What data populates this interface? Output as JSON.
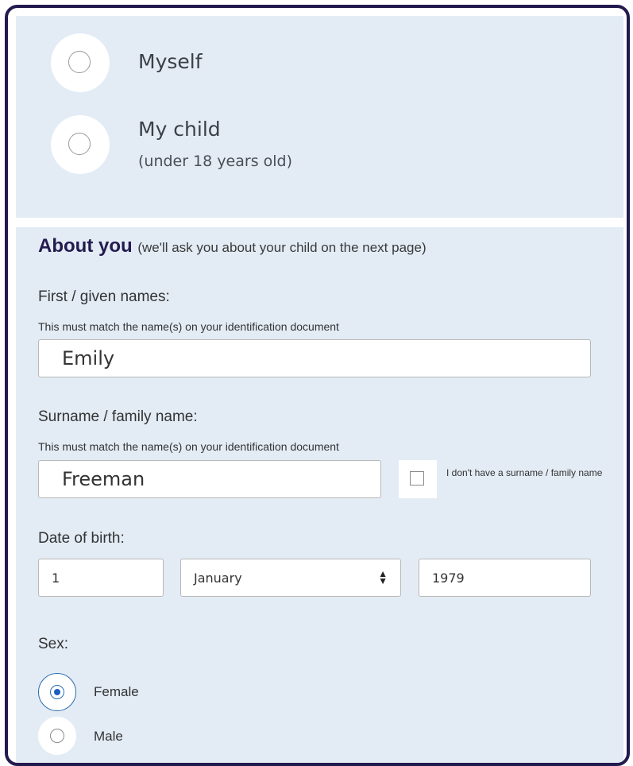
{
  "applicant_choice": {
    "options": [
      {
        "label": "Myself",
        "sublabel": "",
        "selected": false
      },
      {
        "label": "My child",
        "sublabel": "(under 18 years old)",
        "selected": false
      }
    ]
  },
  "about_you": {
    "title": "About you",
    "note": "(we'll ask you about your child on the next page)",
    "first_name": {
      "label": "First / given names:",
      "hint": "This must match the name(s) on your identification document",
      "value": "Emily"
    },
    "surname": {
      "label": "Surname / family name:",
      "hint": "This must match the name(s) on your identification document",
      "value": "Freeman",
      "no_surname_label": "I don't have a surname / family name",
      "no_surname_checked": false
    },
    "dob": {
      "label": "Date of birth:",
      "day": "1",
      "month": "January",
      "year": "1979"
    },
    "sex": {
      "label": "Sex:",
      "options": [
        {
          "label": "Female",
          "selected": true
        },
        {
          "label": "Male",
          "selected": false
        }
      ]
    }
  },
  "colors": {
    "frame": "#231a4f",
    "panel": "#e3ecf5",
    "heading": "#231a4f",
    "radio_selected": "#1a5fc0"
  }
}
